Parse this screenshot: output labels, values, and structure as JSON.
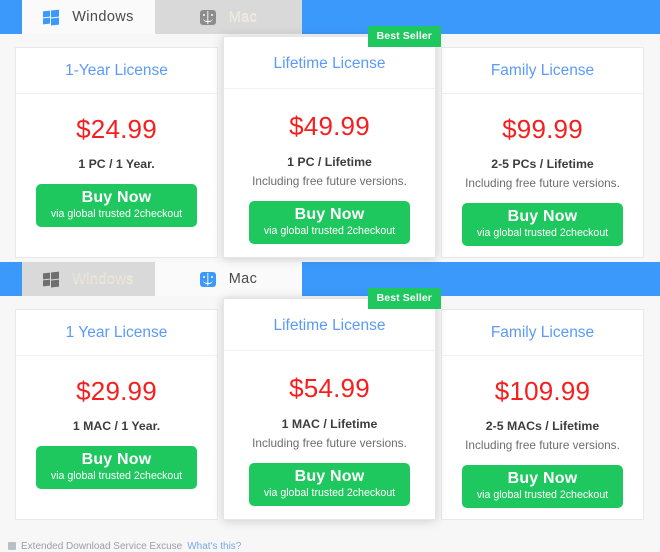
{
  "sections": [
    {
      "id": "windows-section",
      "tabs": [
        {
          "id": "tab-windows",
          "label": "Windows",
          "icon": "windows-icon",
          "active": true
        },
        {
          "id": "tab-mac",
          "label": "Mac",
          "icon": "apple-finder-icon",
          "active": false
        }
      ],
      "cards": [
        {
          "id": "one-year-license",
          "title": "1-Year License",
          "price": "$24.99",
          "terms": "1 PC / 1 Year.",
          "subnote": "",
          "badge": "",
          "featured": false,
          "buy_main": "Buy Now",
          "buy_sub": "via global trusted 2checkout"
        },
        {
          "id": "lifetime-license",
          "title": "Lifetime License",
          "price": "$49.99",
          "terms": "1 PC / Lifetime",
          "subnote": "Including free future versions.",
          "badge": "Best Seller",
          "featured": true,
          "buy_main": "Buy Now",
          "buy_sub": "via global trusted 2checkout"
        },
        {
          "id": "family-license",
          "title": "Family License",
          "price": "$99.99",
          "terms": "2-5 PCs / Lifetime",
          "subnote": "Including free future versions.",
          "badge": "",
          "featured": false,
          "buy_main": "Buy Now",
          "buy_sub": "via global trusted 2checkout"
        }
      ]
    },
    {
      "id": "mac-section",
      "tabs": [
        {
          "id": "tab-windows",
          "label": "Windows",
          "icon": "windows-icon",
          "active": false
        },
        {
          "id": "tab-mac",
          "label": "Mac",
          "icon": "apple-finder-icon",
          "active": true
        }
      ],
      "cards": [
        {
          "id": "one-year-license",
          "title": "1 Year License",
          "price": "$29.99",
          "terms": "1 MAC / 1 Year.",
          "subnote": "",
          "badge": "",
          "featured": false,
          "buy_main": "Buy Now",
          "buy_sub": "via global trusted 2checkout"
        },
        {
          "id": "lifetime-license",
          "title": "Lifetime License",
          "price": "$54.99",
          "terms": "1 MAC / Lifetime",
          "subnote": "Including free future versions.",
          "badge": "Best Seller",
          "featured": true,
          "buy_main": "Buy Now",
          "buy_sub": "via global trusted 2checkout"
        },
        {
          "id": "family-license",
          "title": "Family License",
          "price": "$109.99",
          "terms": "2-5 MACs / Lifetime",
          "subnote": "Including free future versions.",
          "badge": "",
          "featured": false,
          "buy_main": "Buy Now",
          "buy_sub": "via global trusted 2checkout"
        }
      ]
    }
  ],
  "footer": {
    "text": "Extended Download Service Excuse",
    "link": "What's this?"
  },
  "colors": {
    "tab_bar_blue": "#3b99fc",
    "title_blue": "#5b9bf8",
    "price_red": "#f71e1e",
    "buy_green": "#1fc75f",
    "inactive_tab_grey": "#d9d9d9",
    "page_background": "#f7f7f7"
  }
}
